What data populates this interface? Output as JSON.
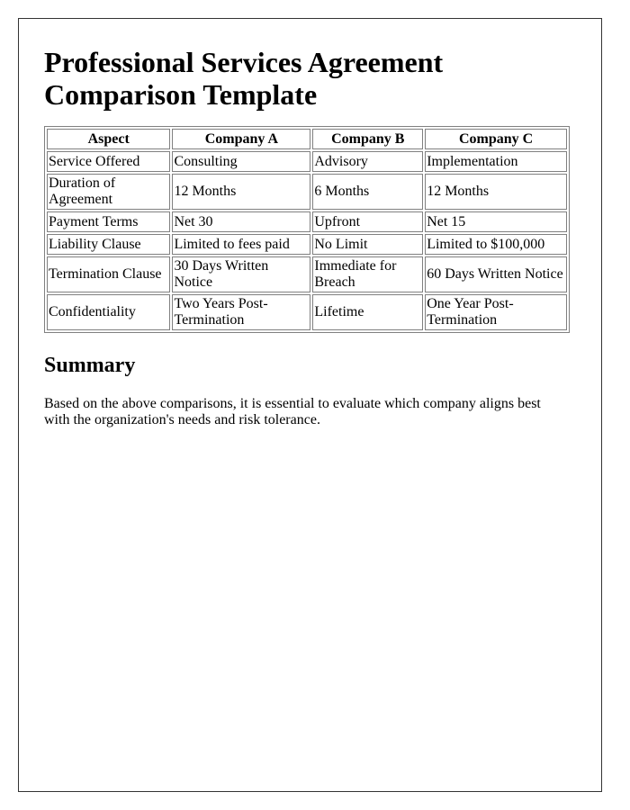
{
  "document": {
    "title": "Professional Services Agreement Comparison Template",
    "table": {
      "headers": [
        "Aspect",
        "Company A",
        "Company B",
        "Company C"
      ],
      "rows": [
        [
          "Service Offered",
          "Consulting",
          "Advisory",
          "Implementation"
        ],
        [
          "Duration of Agreement",
          "12 Months",
          "6 Months",
          "12 Months"
        ],
        [
          "Payment Terms",
          "Net 30",
          "Upfront",
          "Net 15"
        ],
        [
          "Liability Clause",
          "Limited to fees paid",
          "No Limit",
          "Limited to $100,000"
        ],
        [
          "Termination Clause",
          "30 Days Written Notice",
          "Immediate for Breach",
          "60 Days Written Notice"
        ],
        [
          "Confidentiality",
          "Two Years Post-Termination",
          "Lifetime",
          "One Year Post-Termination"
        ]
      ]
    },
    "summary": {
      "heading": "Summary",
      "text": "Based on the above comparisons, it is essential to evaluate which company aligns best with the organization's needs and risk tolerance."
    }
  }
}
